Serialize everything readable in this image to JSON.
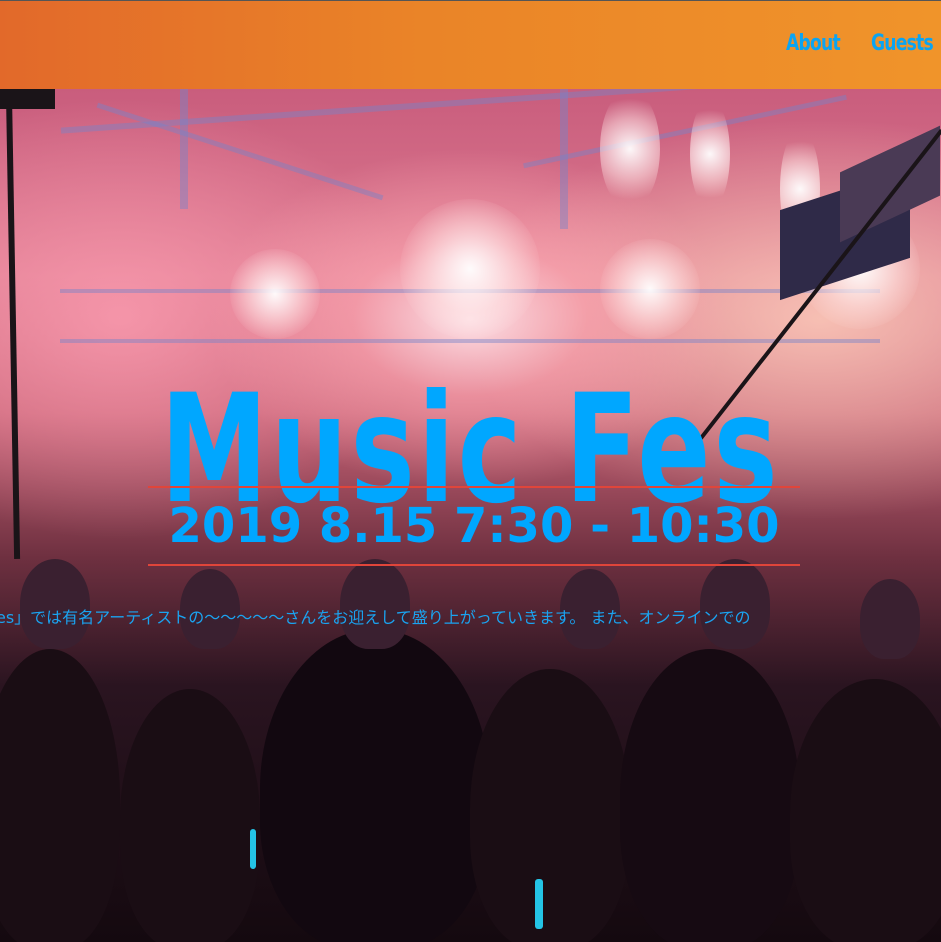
{
  "nav": {
    "items": [
      {
        "label": "About"
      },
      {
        "label": "Guests"
      }
    ]
  },
  "hero": {
    "title": "Music Fes",
    "date": "2019 8.15 7:30 - 10:30",
    "description": "es」では有名アーティストの〜〜〜〜〜さんをお迎えして盛り上がっていきます。 また、オンラインでの"
  },
  "colors": {
    "header_start": "#e2692a",
    "header_end": "#f0942a",
    "accent_blue": "#00a7ff",
    "divider_red": "#e0453a"
  }
}
